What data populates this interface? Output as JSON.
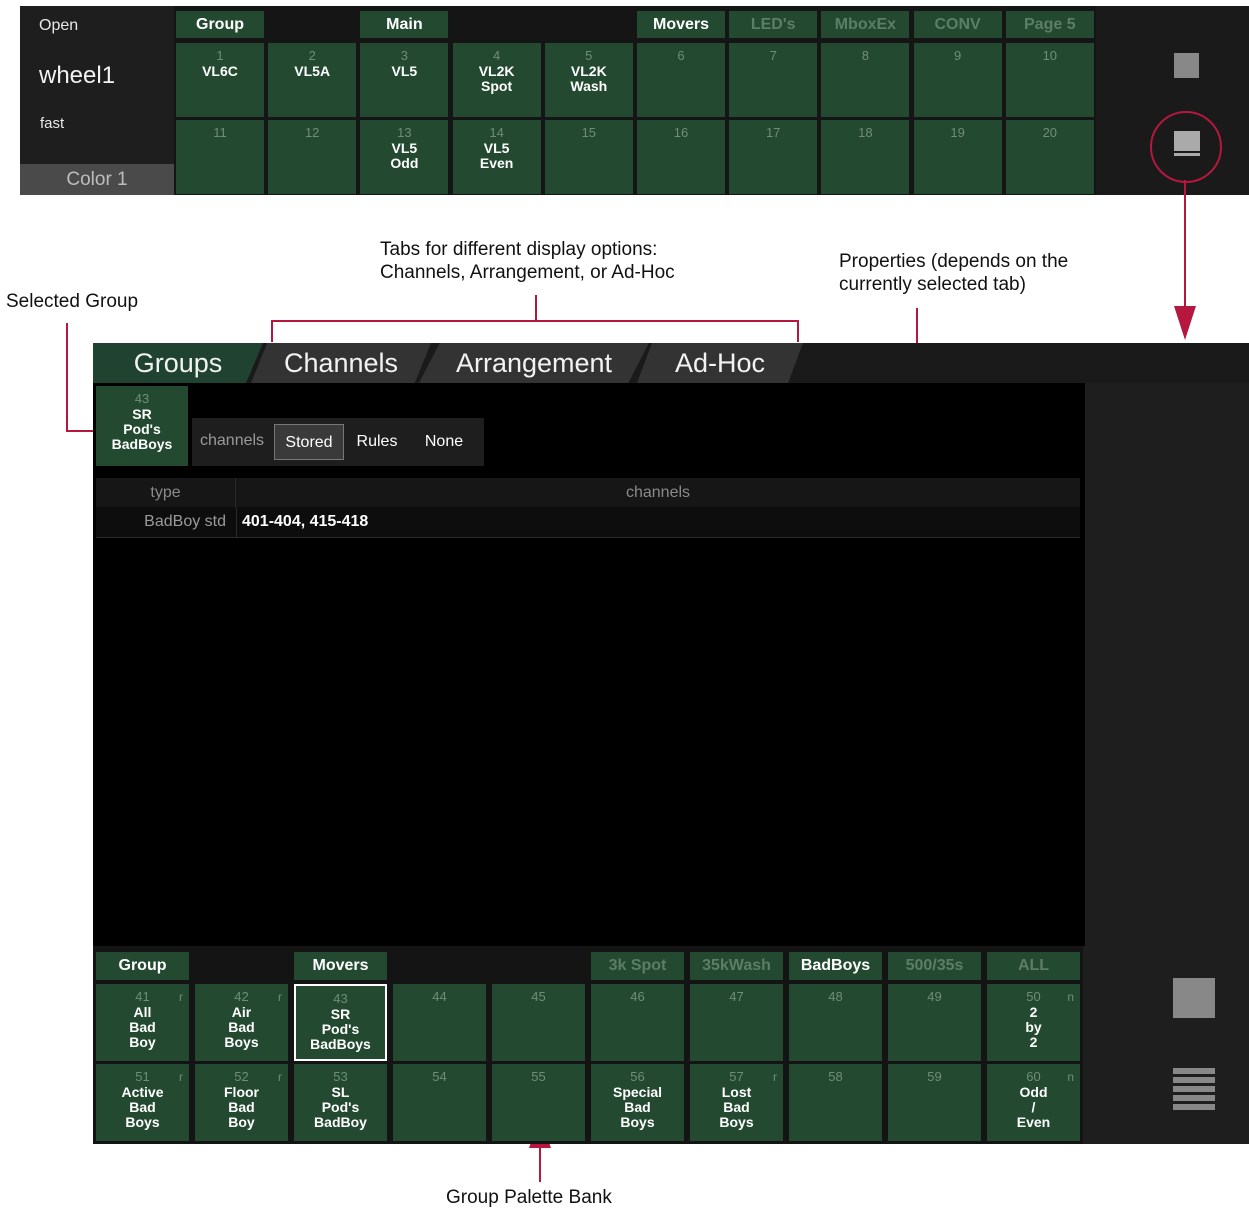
{
  "top_strip": {
    "wheel": {
      "mode": "Open",
      "name": "wheel1",
      "speed": "fast",
      "color_button": "Color 1"
    },
    "tabs": [
      {
        "label": "Group",
        "active": true
      },
      {
        "label": "",
        "active": false
      },
      {
        "label": "Main",
        "active": true
      },
      {
        "label": "",
        "active": false
      },
      {
        "label": "",
        "active": false
      },
      {
        "label": "Movers",
        "active": true
      },
      {
        "label": "LED's",
        "active": false
      },
      {
        "label": "MboxEx",
        "active": false
      },
      {
        "label": "CONV",
        "active": false
      },
      {
        "label": "Page 5",
        "active": false
      }
    ],
    "cells": [
      {
        "num": "1",
        "label": "VL6C"
      },
      {
        "num": "2",
        "label": "VL5A"
      },
      {
        "num": "3",
        "label": "VL5"
      },
      {
        "num": "4",
        "label": "VL2K\nSpot"
      },
      {
        "num": "5",
        "label": "VL2K\nWash"
      },
      {
        "num": "6",
        "label": ""
      },
      {
        "num": "7",
        "label": ""
      },
      {
        "num": "8",
        "label": ""
      },
      {
        "num": "9",
        "label": ""
      },
      {
        "num": "10",
        "label": ""
      },
      {
        "num": "11",
        "label": ""
      },
      {
        "num": "12",
        "label": ""
      },
      {
        "num": "13",
        "label": "VL5\nOdd"
      },
      {
        "num": "14",
        "label": "VL5\nEven"
      },
      {
        "num": "15",
        "label": ""
      },
      {
        "num": "16",
        "label": ""
      },
      {
        "num": "17",
        "label": ""
      },
      {
        "num": "18",
        "label": ""
      },
      {
        "num": "19",
        "label": ""
      },
      {
        "num": "20",
        "label": ""
      }
    ]
  },
  "annotations": {
    "tabs_note": "Tabs for different display options:\nChannels, Arrangement, or Ad-Hoc",
    "properties_note": "Properties (depends on the\ncurrently selected tab)",
    "selected_group": "Selected Group",
    "palette_bank": "Group Palette Bank"
  },
  "panel": {
    "tabs": [
      "Groups",
      "Channels",
      "Arrangement",
      "Ad-Hoc"
    ],
    "selected_group": {
      "num": "43",
      "label": "SR\nPod's\nBadBoys"
    },
    "segment": {
      "label": "channels",
      "options": [
        "Stored",
        "Rules",
        "None"
      ],
      "selected": "Stored"
    },
    "table": {
      "headers": [
        "type",
        "channels"
      ],
      "rows": [
        {
          "type": "BadBoy std",
          "channels": "401-404, 415-418"
        }
      ]
    }
  },
  "bank": {
    "tabs": [
      {
        "label": "Group",
        "active": true
      },
      {
        "label": "",
        "active": false
      },
      {
        "label": "Movers",
        "active": true
      },
      {
        "label": "",
        "active": false
      },
      {
        "label": "",
        "active": false
      },
      {
        "label": "3k Spot",
        "active": false
      },
      {
        "label": "35kWash",
        "active": false
      },
      {
        "label": "BadBoys",
        "active": true
      },
      {
        "label": "500/35s",
        "active": false
      },
      {
        "label": "ALL",
        "active": false
      }
    ],
    "cells": [
      {
        "num": "41",
        "flag": "r",
        "label": "All\nBad\nBoy"
      },
      {
        "num": "42",
        "flag": "r",
        "label": "Air\nBad\nBoys"
      },
      {
        "num": "43",
        "flag": "",
        "label": "SR\nPod's\nBadBoys",
        "selected": true
      },
      {
        "num": "44",
        "flag": "",
        "label": ""
      },
      {
        "num": "45",
        "flag": "",
        "label": ""
      },
      {
        "num": "46",
        "flag": "",
        "label": ""
      },
      {
        "num": "47",
        "flag": "",
        "label": ""
      },
      {
        "num": "48",
        "flag": "",
        "label": ""
      },
      {
        "num": "49",
        "flag": "",
        "label": ""
      },
      {
        "num": "50",
        "flag": "n",
        "label": "2\nby\n2"
      },
      {
        "num": "51",
        "flag": "r",
        "label": "Active\nBad\nBoys"
      },
      {
        "num": "52",
        "flag": "r",
        "label": "Floor\nBad\nBoy"
      },
      {
        "num": "53",
        "flag": "",
        "label": "SL\nPod's\nBadBoy"
      },
      {
        "num": "54",
        "flag": "",
        "label": ""
      },
      {
        "num": "55",
        "flag": "",
        "label": ""
      },
      {
        "num": "56",
        "flag": "",
        "label": "Special\nBad\nBoys"
      },
      {
        "num": "57",
        "flag": "r",
        "label": "Lost\nBad\nBoys"
      },
      {
        "num": "58",
        "flag": "",
        "label": ""
      },
      {
        "num": "59",
        "flag": "",
        "label": ""
      },
      {
        "num": "60",
        "flag": "n",
        "label": "Odd\n/\nEven"
      }
    ]
  },
  "colors": {
    "palette_green": "#234a30",
    "annotation_red": "#b5173f",
    "panel_black": "#000000"
  }
}
